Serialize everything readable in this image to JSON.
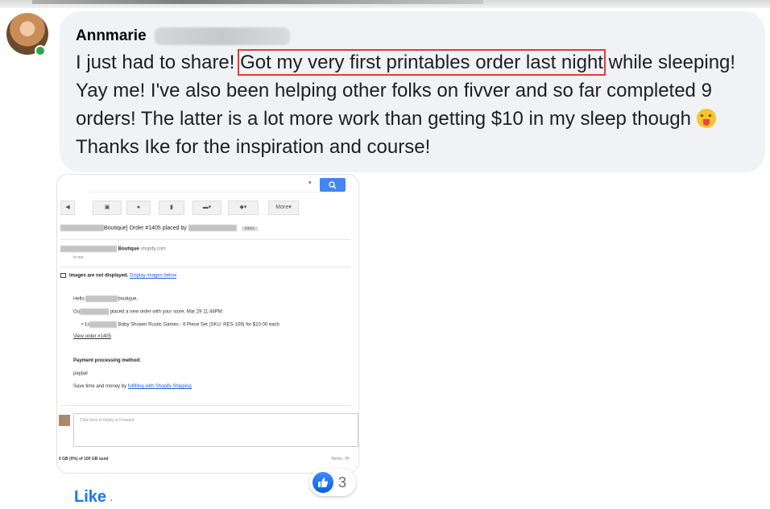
{
  "comment": {
    "author": "Annmarie",
    "text_before": "I just had to share! ",
    "text_highlighted": "Got my very first printables order last night",
    "text_after": " while sleeping! Yay me! I've also been helping other folks on fivver and so far completed 9 orders! The latter is a lot more work than getting $10 in my sleep though ",
    "text_end": " Thanks Ike for the inspiration and course!",
    "emoji": "tongue-out-emoji",
    "online": true
  },
  "email_screenshot": {
    "toolbar_more": "More",
    "subject_part1": "Boutique] Order #1405 placed by",
    "label_chip": "Inbox",
    "sender_name": "Boutique",
    "sender_email": "shopify.com",
    "to_line": "to me",
    "images_note": "Images are not displayed.",
    "images_link": "Display images below",
    "hello": "Hello",
    "hello_suffix": "boutique,",
    "placed_prefix": "Ou",
    "placed_text": "placed a new order with your store, Mar 29 11:44PM:",
    "item_qty": "1x",
    "item_text": "Baby Shower Rustic Games - 6 Piece Set (SKU: RES-109) for $10.00 each",
    "view_order": "View order #1405",
    "payment_title": "Payment processing method:",
    "payment_value": "paypal",
    "save_text": "Save time and money by",
    "save_link": "fulfilling with Shopify Shipping",
    "reply_prompt": "Click here to Reply or Forward",
    "storage": "0 GB (0%) of 100 GB used",
    "terms": "Terms - Pr"
  },
  "reactions": {
    "icon": "like-icon",
    "count": "3"
  },
  "actions": {
    "like": "Like",
    "separator": "·"
  },
  "colors": {
    "bubble": "#f0f2f5",
    "like_blue": "#1877f2",
    "highlight_red": "#e53935",
    "online_green": "#31a24c"
  }
}
